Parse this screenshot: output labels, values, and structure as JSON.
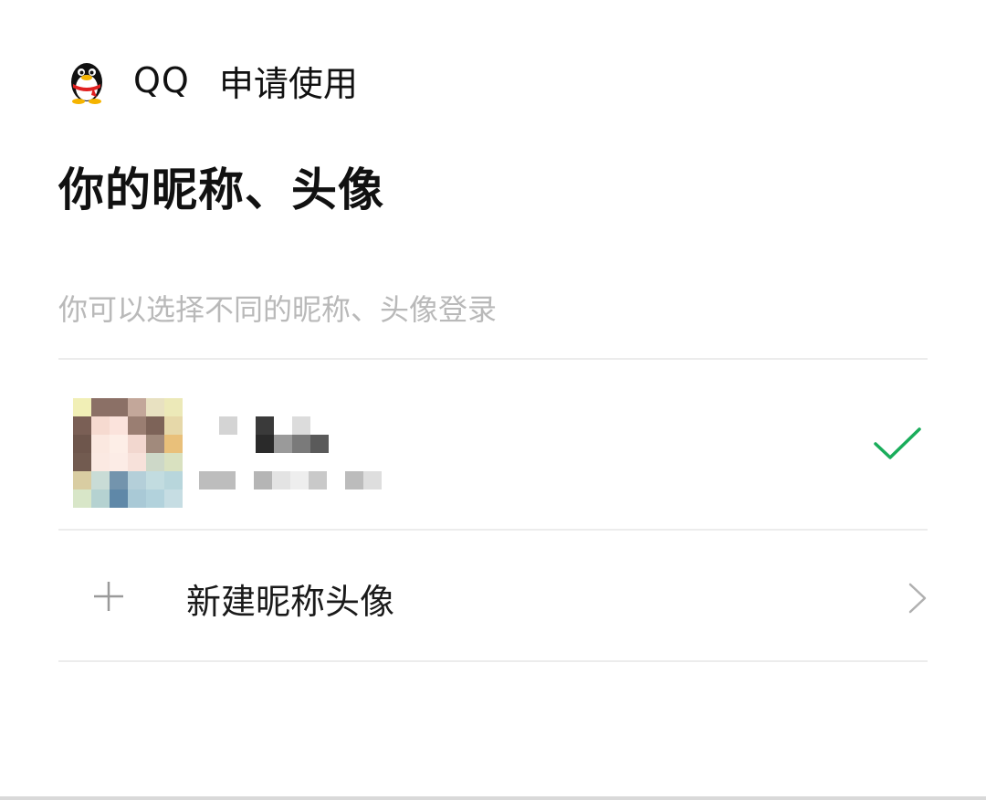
{
  "header": {
    "logo_icon": "qq-penguin-icon",
    "app_name": "QQ",
    "request_label": "申请使用"
  },
  "scope": {
    "title": "你的昵称、头像",
    "hint": "你可以选择不同的昵称、头像登录"
  },
  "accounts": [
    {
      "avatar_icon": "pixelated-avatar",
      "nickname": "",
      "account_id": "",
      "selected": true,
      "selected_icon": "check-icon"
    }
  ],
  "new_profile": {
    "icon": "plus-icon",
    "label": "新建昵称头像",
    "chevron": "chevron-right-icon"
  },
  "colors": {
    "accent_green": "#1aad5b",
    "hint_gray": "#b9b9b9",
    "divider": "#ececec"
  }
}
